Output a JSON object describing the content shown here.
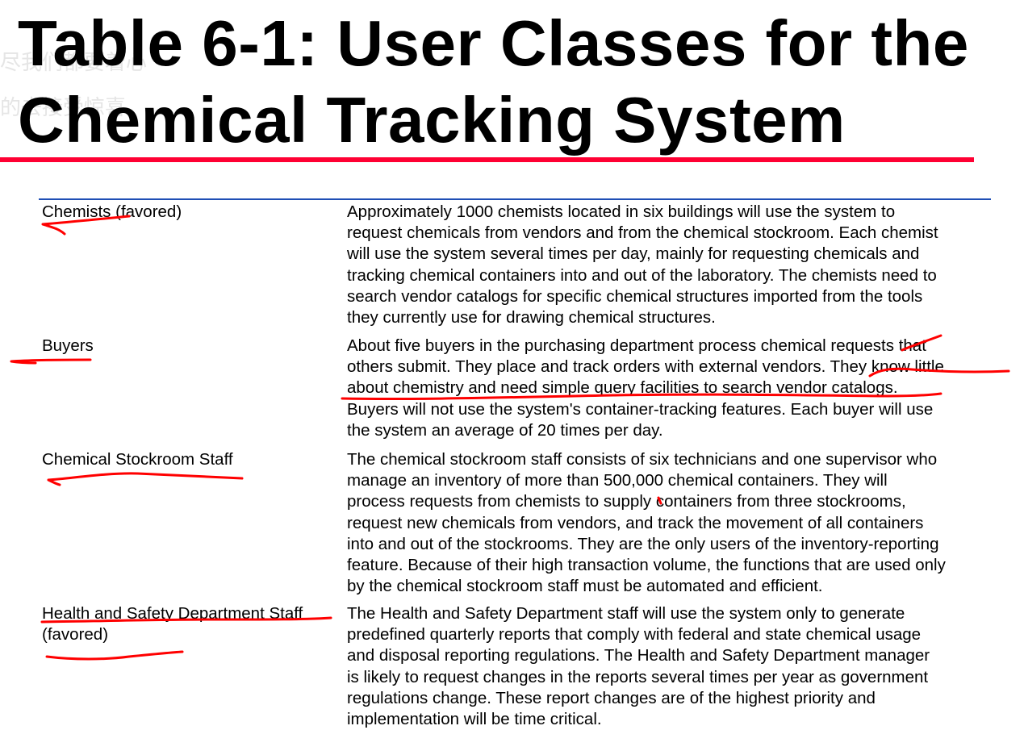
{
  "title_lines": [
    "Table 6-1: User Classes for the",
    "Chemical Tracking System"
  ],
  "watermark_lines": [
    "尽我们都要着心",
    "的去接受惊喜"
  ],
  "rows": [
    {
      "user_class": "Chemists (favored)",
      "description_lines": [
        "Approximately 1000 chemists located in six buildings will use the system to",
        "request chemicals from vendors and from the chemical stockroom. Each chemist",
        "will use the system several times per day, mainly for requesting chemicals and",
        "tracking chemical containers into and out of the laboratory. The chemists need to",
        "search vendor catalogs for specific chemical structures imported from the tools",
        "they currently use for drawing chemical structures."
      ]
    },
    {
      "user_class": "Buyers",
      "description_lines": [
        "About five buyers in the purchasing department process chemical requests that",
        "others submit. They place and track orders with external vendors. They know little",
        "about chemistry and need simple query facilities to search vendor catalogs.",
        "Buyers will not use the system's container-tracking features. Each buyer will use",
        "the system an average of 20 times per day."
      ]
    },
    {
      "user_class": "Chemical Stockroom Staff",
      "description_lines": [
        "The chemical stockroom staff consists of six technicians and one supervisor who",
        "manage an inventory of more than 500,000 chemical containers. They will",
        "process requests from chemists to supply containers from three stockrooms,",
        "request new chemicals from vendors, and track the movement of all containers",
        "into and out of the stockrooms. They are the only users of the inventory-reporting",
        "feature. Because of their high transaction volume, the functions that are used only",
        "by the chemical stockroom staff must be automated and efficient."
      ]
    },
    {
      "user_class": "Health and Safety Department Staff",
      "user_class_line2": "(favored)",
      "description_lines": [
        "The Health and Safety Department staff will use the system only to generate",
        "predefined quarterly reports that comply with federal and state chemical usage",
        "and disposal reporting regulations. The Health and Safety Department manager",
        "is likely to request changes in the reports several times per year as government",
        "regulations change. These report changes are of the highest priority and",
        "implementation will be time critical."
      ]
    }
  ],
  "colors": {
    "title_rule": "#ff0033",
    "table_rule": "#1f4fb5",
    "annotation_ink": "#ff0000"
  }
}
